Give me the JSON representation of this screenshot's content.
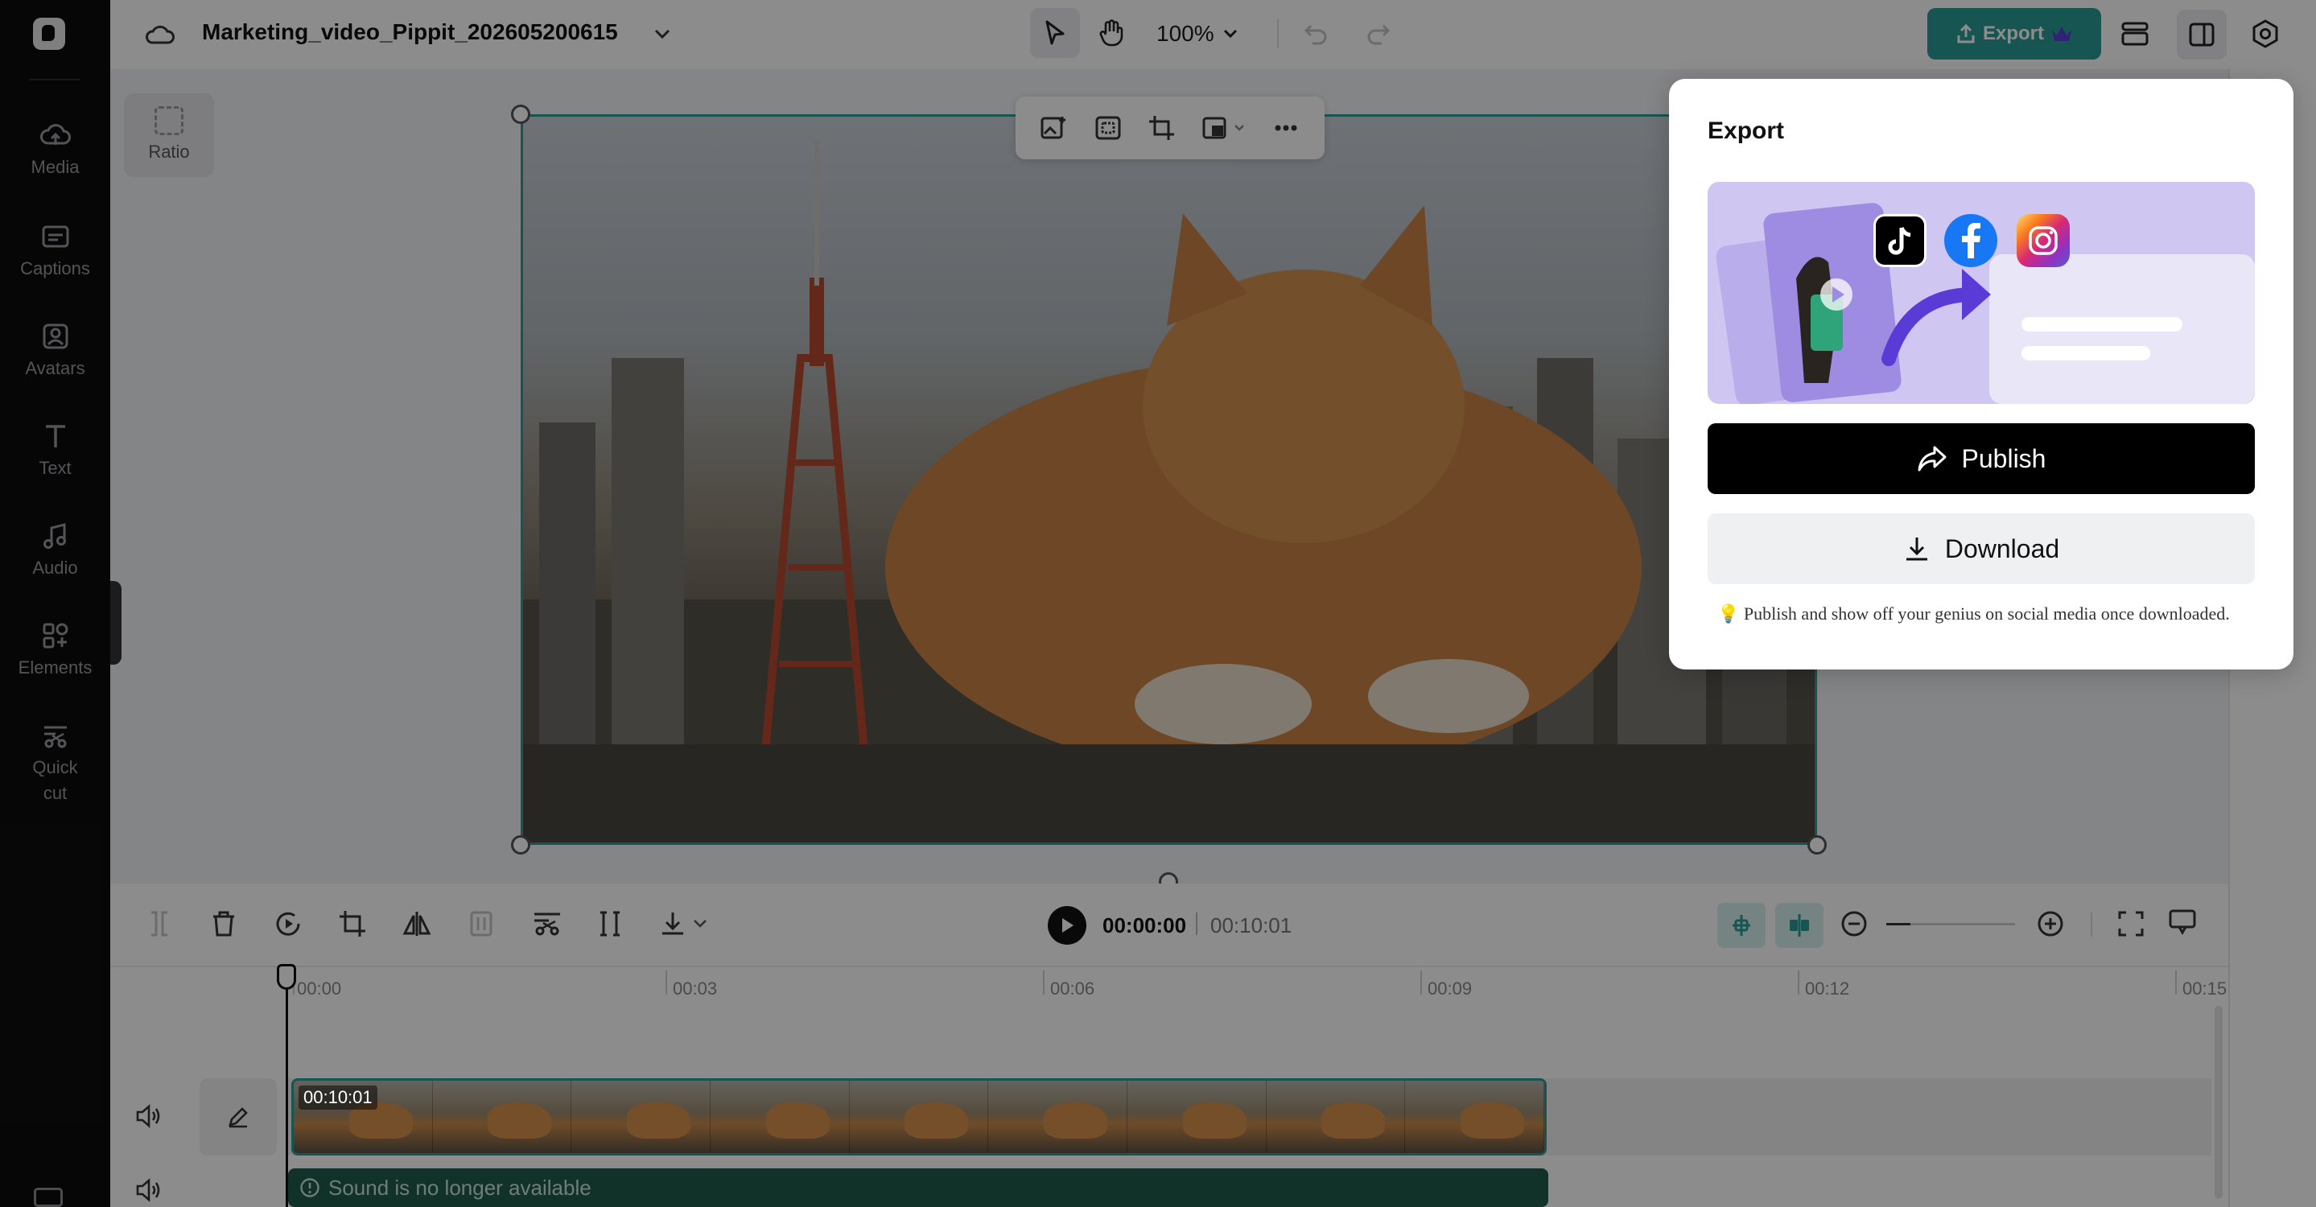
{
  "sidebar": {
    "items": [
      {
        "label": "Media",
        "icon": "cloud-upload-icon"
      },
      {
        "label": "Captions",
        "icon": "captions-icon"
      },
      {
        "label": "Avatars",
        "icon": "avatar-icon"
      },
      {
        "label": "Text",
        "icon": "text-icon"
      },
      {
        "label": "Audio",
        "icon": "music-note-icon"
      },
      {
        "label": "Elements",
        "icon": "elements-icon"
      },
      {
        "label": "Quick",
        "label2": "cut",
        "icon": "quick-cut-icon"
      }
    ]
  },
  "topbar": {
    "project_title": "Marketing_video_Pippit_202605200615",
    "zoom": "100%",
    "export_label": "Export"
  },
  "canvas": {
    "ratio_label": "Ratio"
  },
  "timeline": {
    "current_time": "00:00:00",
    "total_time": "00:10:01",
    "ruler": [
      "00:00",
      "00:03",
      "00:06",
      "00:09",
      "00:12",
      "00:15"
    ],
    "clip_duration": "00:10:01",
    "audio_message": "Sound is no longer available"
  },
  "export_popover": {
    "title": "Export",
    "publish_label": "Publish",
    "download_label": "Download",
    "tip": "Publish and show off your genius on social media once downloaded."
  },
  "colors": {
    "accent": "#2a9c98",
    "sidebar_bg": "#0c0c0d",
    "audio_bar": "#1f5b4a"
  }
}
